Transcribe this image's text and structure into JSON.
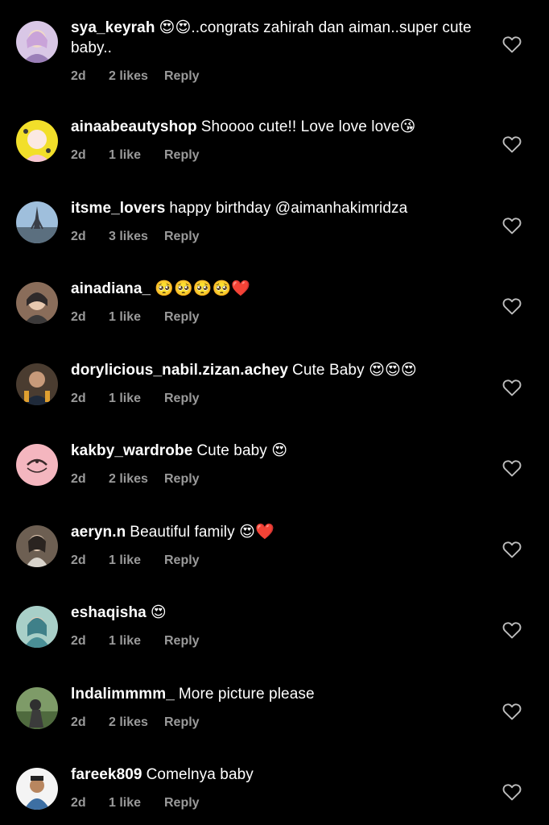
{
  "heart_icon": "heart-outline-icon",
  "reply_label": "Reply",
  "comments": [
    {
      "username": "sya_keyrah",
      "emoji_prefix": "😍😍",
      "text": "..congrats zahirah dan aiman..super cute baby..",
      "emoji_suffix": "",
      "timestamp": "2d",
      "likes": "2 likes",
      "avatar_color": "#d9c7e6"
    },
    {
      "username": "ainaabeautyshop",
      "emoji_prefix": "",
      "text": "Shoooo cute!! Love love love",
      "emoji_suffix": "😘",
      "timestamp": "2d",
      "likes": "1 like",
      "avatar_color": "#f2df2a"
    },
    {
      "username": "itsme_lovers",
      "emoji_prefix": "",
      "text": "happy birthday @aimanhakimridza",
      "emoji_suffix": "",
      "timestamp": "2d",
      "likes": "3 likes",
      "avatar_color": "#7fa6c8"
    },
    {
      "username": "ainadiana_",
      "emoji_prefix": "",
      "text": "",
      "emoji_suffix": "🥺🥺🥺🥺❤️",
      "timestamp": "2d",
      "likes": "1 like",
      "avatar_color": "#8a6d5a"
    },
    {
      "username": "dorylicious_nabil.zizan.achey",
      "emoji_prefix": "",
      "text": "Cute Baby",
      "emoji_suffix": "😍😍😍",
      "timestamp": "2d",
      "likes": "1 like",
      "avatar_color": "#5a4a3a"
    },
    {
      "username": "kakby_wardrobe",
      "emoji_prefix": "",
      "text": "Cute baby",
      "emoji_suffix": "😍",
      "timestamp": "2d",
      "likes": "2 likes",
      "avatar_color": "#f4b6bf"
    },
    {
      "username": "aeryn.n",
      "emoji_prefix": "",
      "text": "Beautiful family",
      "emoji_suffix": "😍❤️",
      "timestamp": "2d",
      "likes": "1 like",
      "avatar_color": "#6d5f52"
    },
    {
      "username": "eshaqisha",
      "emoji_prefix": "",
      "text": "",
      "emoji_suffix": "😍",
      "timestamp": "2d",
      "likes": "1 like",
      "avatar_color": "#7fb3b6"
    },
    {
      "username": "lndalimmmm_",
      "emoji_prefix": "",
      "text": "More picture please",
      "emoji_suffix": "",
      "timestamp": "2d",
      "likes": "2 likes",
      "avatar_color": "#6e8a56"
    },
    {
      "username": "fareek809",
      "emoji_prefix": "",
      "text": "Comelnya baby",
      "emoji_suffix": "",
      "timestamp": "2d",
      "likes": "1 like",
      "avatar_color": "#3d6fa3"
    }
  ]
}
